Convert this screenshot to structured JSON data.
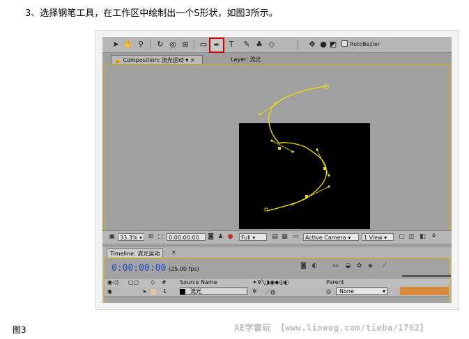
{
  "caption": {
    "step": "3、选择钢笔工具，在工作区中绘制出一个S形状，如图3所示。",
    "figure_label": "图3",
    "watermark": "AE学雷玩 【www.lineeg.com/tieba/1762】"
  },
  "toolbar": {
    "tools": [
      "selection-tool",
      "hand-tool",
      "zoom-tool",
      "rotate-tool",
      "orbit-camera-tool",
      "pan-behind-tool",
      "rectangle-mask-tool",
      "pen-tool",
      "text-tool",
      "brush-tool",
      "clone-stamp-tool",
      "eraser-tool",
      "local-axis-mode",
      "world-axis-mode",
      "view-axis-mode"
    ],
    "selected_tool": "pen-tool",
    "roto_bezier_label": "RotoBezier"
  },
  "tabs": {
    "composition_label": "Composition: 流光运动",
    "layer_label": "Layer: 流光"
  },
  "viewer": {
    "zoom": "33.3%",
    "timecode": "0:00:00:00",
    "resolution": "Full",
    "camera": "Active Camera",
    "views": "1 View"
  },
  "timeline": {
    "tab_label": "Timeline: 流光运动",
    "timecode": "0:00:00:00",
    "fps": "(25.00 fps)",
    "columns": {
      "hash": "#",
      "source_name": "Source Name",
      "parent": "Parent"
    },
    "layer": {
      "index": "1",
      "name": "流光",
      "parent": "None",
      "label_color": "#e8c49a"
    }
  },
  "colors": {
    "path": "#f0e000",
    "comp_border": "#e2b000",
    "timecode": "#1e46c8",
    "pen_highlight": "#d40000"
  }
}
